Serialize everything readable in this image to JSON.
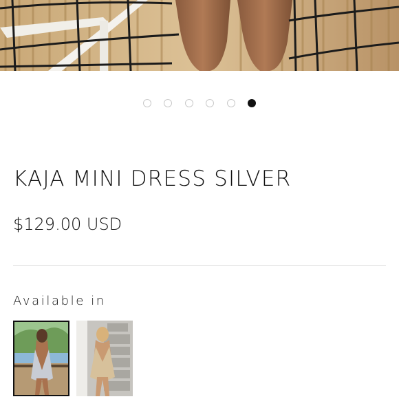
{
  "product": {
    "title": "KAJA MINI DRESS SILVER",
    "price": "$129.00 USD"
  },
  "carousel": {
    "total": 6,
    "active_index": 5
  },
  "variants": {
    "heading": "Available in",
    "items": [
      {
        "name": "variant-silver",
        "selected": true
      },
      {
        "name": "variant-gold",
        "selected": false
      }
    ]
  },
  "colors": {
    "text": "#111111",
    "dot_inactive": "#c9c9c9",
    "divider": "#dcdcdc"
  }
}
